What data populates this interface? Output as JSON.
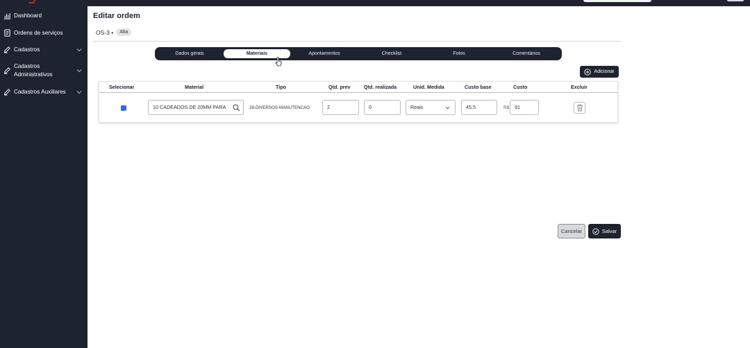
{
  "sidebar": {
    "items": [
      {
        "label": "Dashboard",
        "icon": "bar-chart-icon"
      },
      {
        "label": "Ordens de serviços",
        "icon": "document-icon"
      },
      {
        "label": "Cadastros",
        "icon": "edit-icon"
      },
      {
        "label_line1": "Cadastros",
        "label_line2": "Administrativos",
        "icon": "edit-icon"
      },
      {
        "label": "Cadastros Auxiliares",
        "icon": "edit-icon"
      }
    ]
  },
  "header": {
    "title": "Editar ordem",
    "os_code": "OS-3 •",
    "priority_badge": "Alta"
  },
  "tabs": [
    {
      "label": "Dados gerais",
      "active": false
    },
    {
      "label": "Materiais",
      "active": true
    },
    {
      "label": "Apontamentos",
      "active": false
    },
    {
      "label": "Checklist",
      "active": false
    },
    {
      "label": "Fotos",
      "active": false
    },
    {
      "label": "Comentários",
      "active": false
    }
  ],
  "toolbar": {
    "add_label": "Adicionar"
  },
  "table": {
    "columns": [
      "Selecionar",
      "Material",
      "Tipo",
      "Qtd. prev",
      "Qtd. realizada",
      "Unid. Medida",
      "Custo base",
      "Custo",
      "Excluir"
    ],
    "rows": [
      {
        "selected": true,
        "material": "10 CADEADOS DE 20MM PARA",
        "tipo": "28-DIVERSOS-MANUTENCAO",
        "qtd_prev": "2",
        "qtd_realizada": "0",
        "unid_medida": "Reais",
        "custo_base": "45.5",
        "currency": "R$",
        "custo": "91"
      }
    ]
  },
  "footer": {
    "cancel_label": "Cancelar",
    "save_label": "Salvar"
  },
  "colors": {
    "sidebar_bg": "#1e2330",
    "accent_checkbox": "#2f6fd6",
    "brand_red": "#c62828"
  }
}
